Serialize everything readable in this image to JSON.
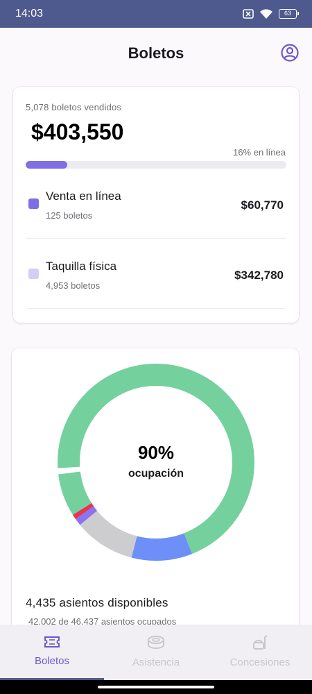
{
  "status_bar": {
    "time": "14:03",
    "battery": "63",
    "icons": [
      "sim-off-icon",
      "wifi-icon",
      "battery-icon"
    ]
  },
  "header": {
    "title": "Boletos",
    "profile_icon": "account-circle-icon"
  },
  "sales": {
    "sold_label": "5,078 boletos vendidos",
    "total": "$403,550",
    "online_pct_label": "16% en línea",
    "online_fraction": 0.16,
    "channels": [
      {
        "name": "Venta en línea",
        "count": "125 boletos",
        "amount": "$60,770",
        "color": "#7e6fe5"
      },
      {
        "name": "Taquilla física",
        "count": "4,953 boletos",
        "amount": "$342,780",
        "color": "#d5cdf7"
      }
    ]
  },
  "occupancy": {
    "percent": "90%",
    "label": "ocupación",
    "available": "4,435 asientos disponibles",
    "occupied": "42,002 de 46,437 asientos ocupados",
    "segments": [
      {
        "fraction": 0.7,
        "color": "#74d19d"
      },
      {
        "fraction": 0.1,
        "color": "#6f8ff8"
      },
      {
        "fraction": 0.1,
        "color": "#cdcdd0"
      },
      {
        "fraction": 0.012,
        "color": "#8b74ef"
      },
      {
        "fraction": 0.008,
        "color": "#e9344f"
      },
      {
        "fraction": 0.07,
        "color": "#74d19d"
      }
    ]
  },
  "nav": {
    "items": [
      {
        "label": "Boletos",
        "icon": "ticket-icon",
        "active": true
      },
      {
        "label": "Asistencia",
        "icon": "stadium-icon",
        "active": false
      },
      {
        "label": "Concesiones",
        "icon": "food-icon",
        "active": false
      }
    ],
    "active_color": "#6a5acd",
    "inactive_color": "#c9c6cf"
  }
}
